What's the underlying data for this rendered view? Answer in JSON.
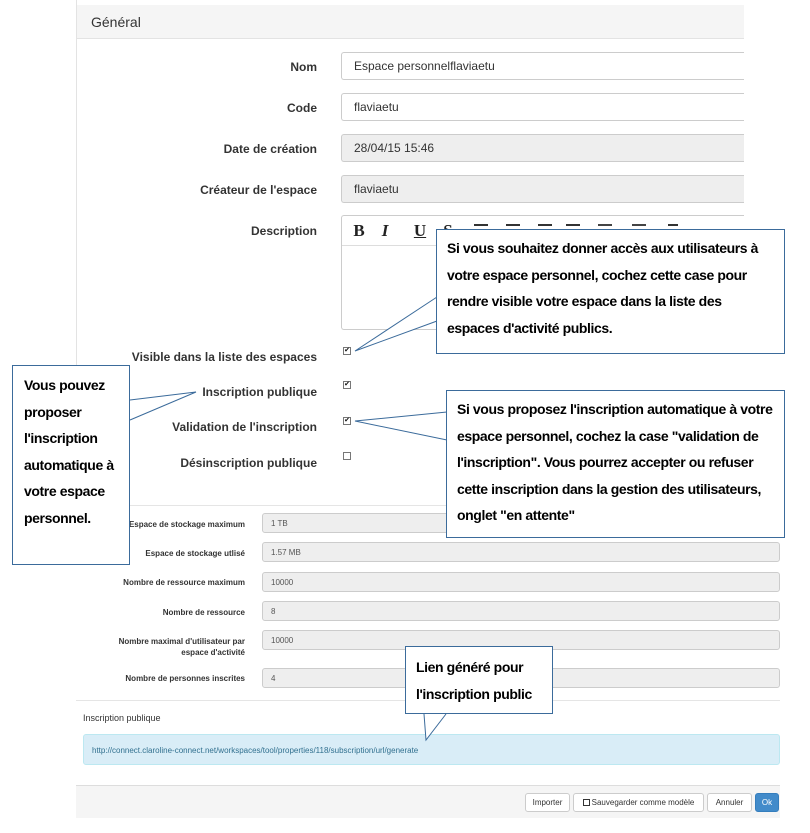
{
  "panel": {
    "title": "Général"
  },
  "fields": {
    "nom": {
      "label": "Nom",
      "value": "Espace personnelflaviaetu"
    },
    "code": {
      "label": "Code",
      "value": "flaviaetu"
    },
    "date": {
      "label": "Date de création",
      "value": "28/04/15 15:46"
    },
    "createur": {
      "label": "Créateur de l'espace",
      "value": "flaviaetu"
    },
    "description": {
      "label": "Description"
    }
  },
  "editor": {
    "bold": "B",
    "italic": "I",
    "underline": "U",
    "strike": "S"
  },
  "checkboxes": {
    "visible": {
      "label": "Visible dans la liste des espaces",
      "checked": true
    },
    "inscription": {
      "label": "Inscription publique",
      "checked": true
    },
    "validation": {
      "label": "Validation de l'inscription",
      "checked": true
    },
    "desinscription": {
      "label": "Désinscription publique",
      "checked": false
    }
  },
  "check_mark": "✔",
  "stats": [
    {
      "label": "Espace de stockage maximum",
      "value": "1 TB"
    },
    {
      "label": "Espace de stockage utlisé",
      "value": "1.57 MB"
    },
    {
      "label": "Nombre de ressource maximum",
      "value": "10000"
    },
    {
      "label": "Nombre de ressource",
      "value": "8"
    },
    {
      "label": "Nombre maximal d'utilisateur par espace d'activité",
      "value": "10000"
    },
    {
      "label": "Nombre de personnes inscrites",
      "value": "4"
    }
  ],
  "inscription_link": {
    "label": "Inscription publique",
    "url": "http://connect.claroline-connect.net/workspaces/tool/properties/118/subscription/url/generate"
  },
  "footer": {
    "import": "Importer",
    "save_model": "Sauvegarder comme modèle",
    "cancel": "Annuler",
    "ok": "Ok"
  },
  "callouts": {
    "visible": "Si vous souhaitez donner accès aux utilisateurs à votre espace personnel, cochez cette case pour rendre visible votre espace dans la liste des espaces d'activité publics.",
    "inscription": "Vous pouvez proposer l'inscription automatique à votre espace personnel.",
    "validation": "Si vous proposez l'inscription automatique à votre espace personnel, cochez la case \"validation de l'inscription\". Vous pourrez accepter ou refuser cette inscription dans la gestion des utilisateurs, onglet  \"en attente\"",
    "lien": "Lien généré pour l'inscription public"
  },
  "colors": {
    "callout_border": "#3b6b9b",
    "info_bg": "#d9edf7",
    "primary": "#428bca"
  }
}
